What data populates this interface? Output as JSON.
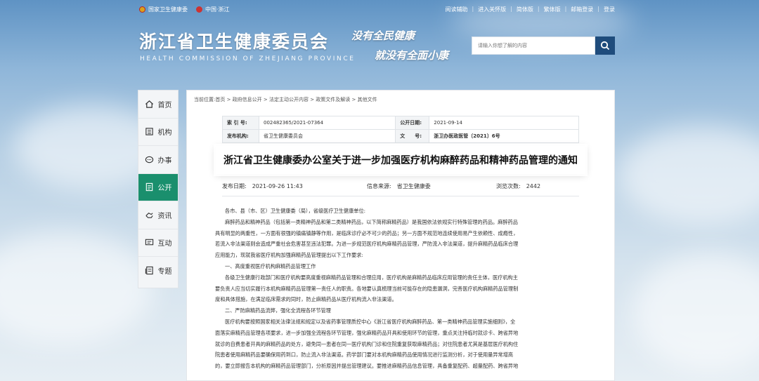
{
  "topbar": {
    "left_links": [
      "国家卫生健康委",
      "中国·浙江"
    ],
    "right_links": [
      "阅读辅助",
      "进入关怀版",
      "简体版",
      "繁体版",
      "邮箱登录",
      "登录"
    ]
  },
  "header": {
    "title": "浙江省卫生健康委员会",
    "subtitle": "HEALTH COMMISSION OF ZHEJIANG PROVINCE",
    "slogan_line1": "没有全民健康",
    "slogan_line2": "就没有全面小康",
    "search_placeholder": "请输入你想了解的内容"
  },
  "sidenav": {
    "items": [
      {
        "label": "首页",
        "icon": "home-icon"
      },
      {
        "label": "机构",
        "icon": "building-icon"
      },
      {
        "label": "办事",
        "icon": "chat-icon"
      },
      {
        "label": "公开",
        "icon": "document-icon",
        "active": true
      },
      {
        "label": "资讯",
        "icon": "hand-icon"
      },
      {
        "label": "互动",
        "icon": "interact-icon"
      },
      {
        "label": "专题",
        "icon": "topic-icon"
      }
    ]
  },
  "breadcrumb": "当前位置:首页 > 政府信息公开 > 法定主动公开内容 > 政策文件及解读 > 其他文件",
  "meta": {
    "index_label": "索 引 号:",
    "index_value": "002482365/2021-07364",
    "date_label": "公开日期:",
    "date_value": "2021-09-14",
    "org_label": "发布机构:",
    "org_value": "省卫生健康委员会",
    "docno_label": "文　　号:",
    "docno_value": "浙卫办医政医管〔2021〕6号"
  },
  "article": {
    "title": "浙江省卫生健康委办公室关于进一步加强医疗机构麻醉药品和精神药品管理的通知",
    "publish_date": "发布日期:　2021-09-26 11:43",
    "source": "信息来源:　省卫生健康委",
    "views": "浏览次数:　2442",
    "paragraphs": [
      "各市、县（市、区）卫生健康委（局），省级医疗卫生健康单位:",
      "麻醉药品和精神药品（包括第一类精神药品和第二类精神药品，以下简称麻精药品）是我国依法依规实行特殊管理的药品。麻醉药品",
      "具有明显的两重性，一方面有很强的镇痛镇静等作用，是临床诊疗必不可少的药品；另一方面不规范地连续使用易产生依赖性、成瘾性，",
      "若流入非法渠道则会造成严重社会危害甚至违法犯罪。为进一步规范医疗机构麻精药品管理，严防流入非法渠道，提升麻精药品临床合理",
      "应用能力，现就我省医疗机构加强麻精药品管理提出以下工作要求:",
      "一、高度重视医疗机构麻精药品管理工作",
      "各级卫生健康行政部门和医疗机构要高度重视麻精药品管理和合理应用，医疗机构是麻精药品临床应用管理的责任主体，医疗机构主",
      "要负责人应当切实履行本机构麻精药品管理第一责任人的职责。各地要认真梳理当前可能存在的隐患漏洞，完善医疗机构麻精药品管理制",
      "度和具体措施，在满足临床需求的同时，防止麻精药品从医疗机构流入非法渠道。",
      "二、严防麻精药品流弊，强化全流程各环节管理",
      "医疗机构要按照国家相关法律法规和规定以及省药事管理质控中心《浙江省医疗机构麻醉药品、第一类精神药品管理实施细则》，全",
      "面落实麻精药品管理各项要求，进一步加强全流程各环节管理，强化麻精药品开具和使用环节的管理，重点关注持临时就诊卡、跨省异地",
      "就诊的自费患者开具的麻精药品的处方，避免同一患者在同一医疗机构门诊和住院重复获取麻精药品；对住院患者尤其是基层医疗机构住",
      "院患者使用麻精药品要确保用药到口，防止流入非法渠道。药学部门要对本机构麻精药品使用情况进行监测分析，对于使用量异常增高",
      "的，要立即报告本机构的麻精药品管理部门，分析原因并提出管理建议。要推进麻精药品信息管理，具备重复配药、超量配药、跨省异地"
    ]
  }
}
